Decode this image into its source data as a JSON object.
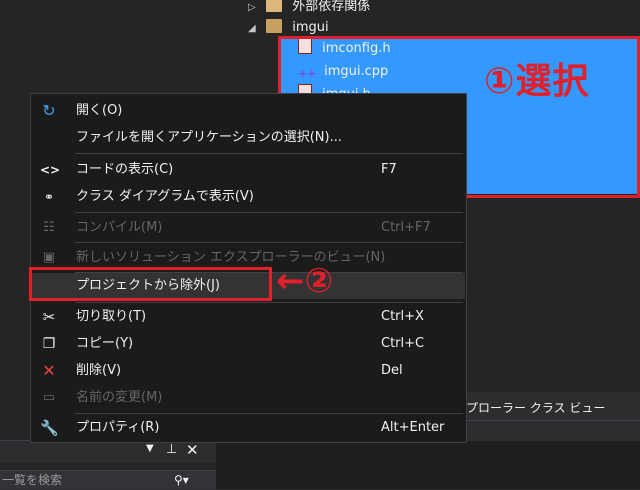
{
  "tree": {
    "items": [
      {
        "label": "外部依存関係",
        "arrow": "▷"
      },
      {
        "label": "imgui",
        "arrow": "◢"
      },
      {
        "label": "imconfig.h"
      },
      {
        "label": "imgui.cpp"
      },
      {
        "label": "imgui.h"
      }
    ]
  },
  "annotation1": "①選択",
  "annotation2": "←②",
  "menu": {
    "items": [
      {
        "label": "開く(O)",
        "shortcut": "",
        "icon": "open-arrow-icon",
        "disabled": false
      },
      {
        "label": "ファイルを開くアプリケーションの選択(N)...",
        "shortcut": "",
        "icon": "",
        "disabled": false
      },
      {
        "label": "コードの表示(C)",
        "shortcut": "F7",
        "icon": "code-brackets-icon",
        "disabled": false
      },
      {
        "label": "クラス ダイアグラムで表示(V)",
        "shortcut": "",
        "icon": "class-diagram-icon",
        "disabled": false
      },
      {
        "label": "コンパイル(M)",
        "shortcut": "Ctrl+F7",
        "icon": "compile-icon",
        "disabled": true
      },
      {
        "label": "新しいソリューション エクスプローラーのビュー(N)",
        "shortcut": "",
        "icon": "new-view-icon",
        "disabled": true
      },
      {
        "label": "プロジェクトから除外(J)",
        "shortcut": "",
        "icon": "",
        "disabled": false
      },
      {
        "label": "切り取り(T)",
        "shortcut": "Ctrl+X",
        "icon": "scissors-icon",
        "disabled": false
      },
      {
        "label": "コピー(Y)",
        "shortcut": "Ctrl+C",
        "icon": "copy-icon",
        "disabled": false
      },
      {
        "label": "削除(V)",
        "shortcut": "Del",
        "icon": "delete-x-icon",
        "disabled": false
      },
      {
        "label": "名前の変更(M)",
        "shortcut": "",
        "icon": "rename-icon",
        "disabled": true
      },
      {
        "label": "プロパティ(R)",
        "shortcut": "Alt+Enter",
        "icon": "wrench-icon",
        "disabled": false
      }
    ]
  },
  "bottom": {
    "tabs_text": "プローラー  クラス ビュー",
    "search_placeholder": "一覧を検索"
  },
  "colors": {
    "selection": "#3399ff",
    "annotation": "#e0202a",
    "menu_bg": "#1b1b1c"
  }
}
